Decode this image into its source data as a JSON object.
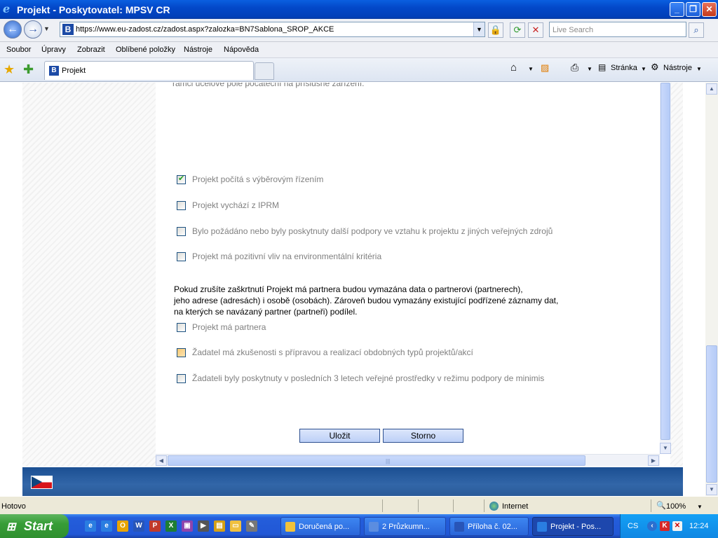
{
  "window": {
    "title": "Projekt - Poskytovatel: MPSV CR"
  },
  "address": {
    "url": "https://www.eu-zadost.cz/zadost.aspx?zalozka=BN7Sablona_SROP_AKCE",
    "search_placeholder": "Live Search"
  },
  "menu": [
    "Soubor",
    "Úpravy",
    "Zobrazit",
    "Oblíbené položky",
    "Nástroje",
    "Nápověda"
  ],
  "tab": {
    "label": "Projekt",
    "favicon_letter": "B"
  },
  "commands": {
    "page": "Stránka",
    "tools": "Nástroje"
  },
  "content": {
    "cut_text": "rámci účelové pole počáteční na příslušné zařízení.",
    "checkboxes": [
      {
        "label": "Projekt počítá s výběrovým řízením",
        "checked": true
      },
      {
        "label": "Projekt vychází z IPRM",
        "checked": false
      },
      {
        "label": "Bylo požádáno nebo byly poskytnuty další podpory ve vztahu k projektu z jiných veřejných zdrojů",
        "checked": false
      },
      {
        "label": "Projekt má pozitivní vliv na environmentální kritéria",
        "checked": false
      },
      {
        "label": "Projekt má partnera",
        "checked": false
      },
      {
        "label": "Žadatel má zkušenosti s přípravou a realizací obdobných typů projektů/akcí",
        "checked": false,
        "highlighted": true
      },
      {
        "label": "Žadateli byly poskytnuty v posledních 3 letech veřejné prostředky v režimu podpory de minimis",
        "checked": false
      }
    ],
    "note": [
      "Pokud zrušíte zaškrtnutí Projekt má partnera budou vymazána data o partnerovi (partnerech),",
      "jeho adrese (adresách) i osobě (osobách). Zároveň budou vymazány existující podřízené záznamy dat,",
      "na kterých se navázaný partner (partneři) podílel."
    ],
    "buttons": {
      "save": "Uložit",
      "cancel": "Storno"
    }
  },
  "status": {
    "text": "Hotovo",
    "zone": "Internet",
    "zoom": "100%"
  },
  "taskbar": {
    "start": "Start",
    "tasks": [
      "Doručená po...",
      "2 Průzkumn...",
      "Příloha č. 02...",
      "Projekt - Pos..."
    ],
    "lang": "CS",
    "clock": "12:24"
  },
  "colors": {
    "titlebar": "#0348c9",
    "footer": "#2a5a98",
    "button": "#bdd0f7",
    "checkbox_label": "#808080",
    "taskbar": "#245edb",
    "start": "#379d37"
  }
}
